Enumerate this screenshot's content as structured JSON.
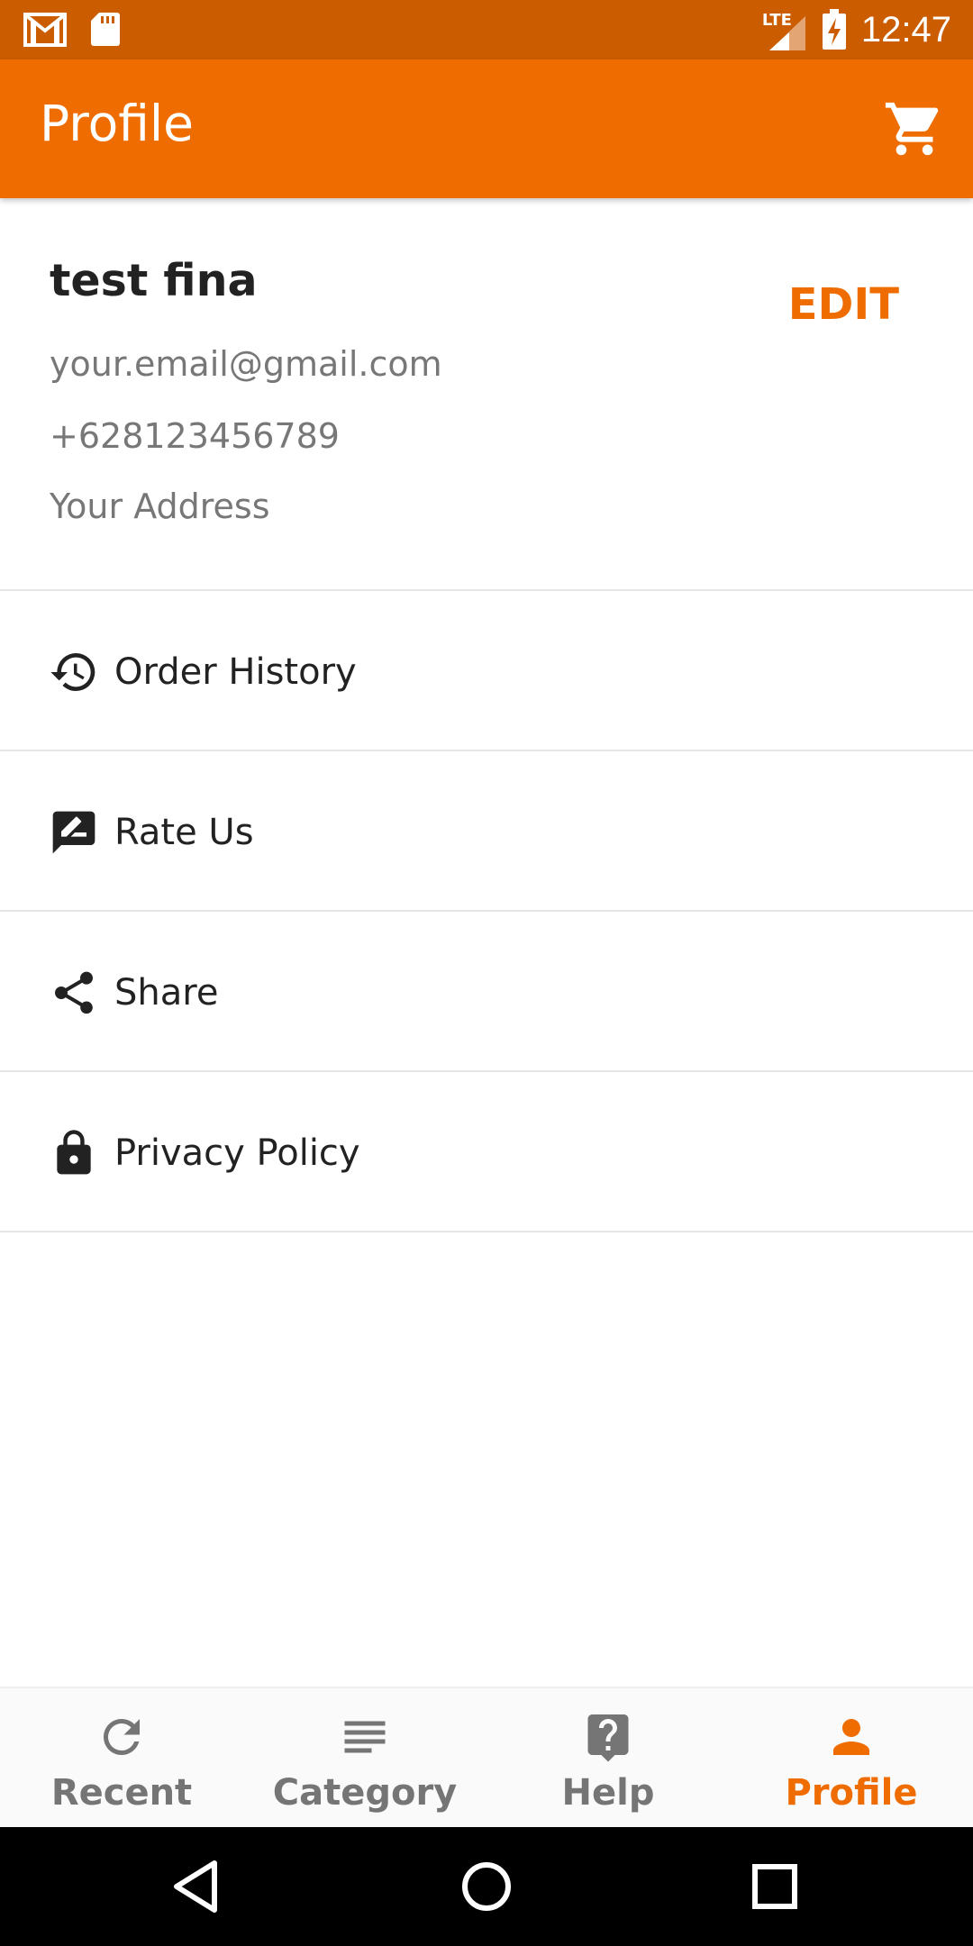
{
  "status_bar": {
    "time": "12:47",
    "network": "LTE",
    "left_icons": [
      "gmail-icon",
      "sd-card-icon"
    ],
    "right_icons": [
      "signal-icon",
      "battery-charging-icon"
    ]
  },
  "app_bar": {
    "title": "Profile",
    "action_icon": "cart-icon"
  },
  "profile": {
    "name": "test fina",
    "email": "your.email@gmail.com",
    "phone": "+628123456789",
    "address": "Your Address",
    "edit_label": "EDIT"
  },
  "menu": {
    "items": [
      {
        "label": "Order History",
        "icon": "history-icon"
      },
      {
        "label": "Rate Us",
        "icon": "rate-review-icon"
      },
      {
        "label": "Share",
        "icon": "share-icon"
      },
      {
        "label": "Privacy Policy",
        "icon": "lock-icon"
      }
    ]
  },
  "bottom_nav": {
    "items": [
      {
        "label": "Recent",
        "icon": "refresh-icon",
        "active": false
      },
      {
        "label": "Category",
        "icon": "list-icon",
        "active": false
      },
      {
        "label": "Help",
        "icon": "help-icon",
        "active": false
      },
      {
        "label": "Profile",
        "icon": "person-icon",
        "active": true
      }
    ]
  },
  "colors": {
    "accent": "#ef6c00",
    "status_bar": "#cb5c00",
    "inactive_nav": "#757575"
  }
}
